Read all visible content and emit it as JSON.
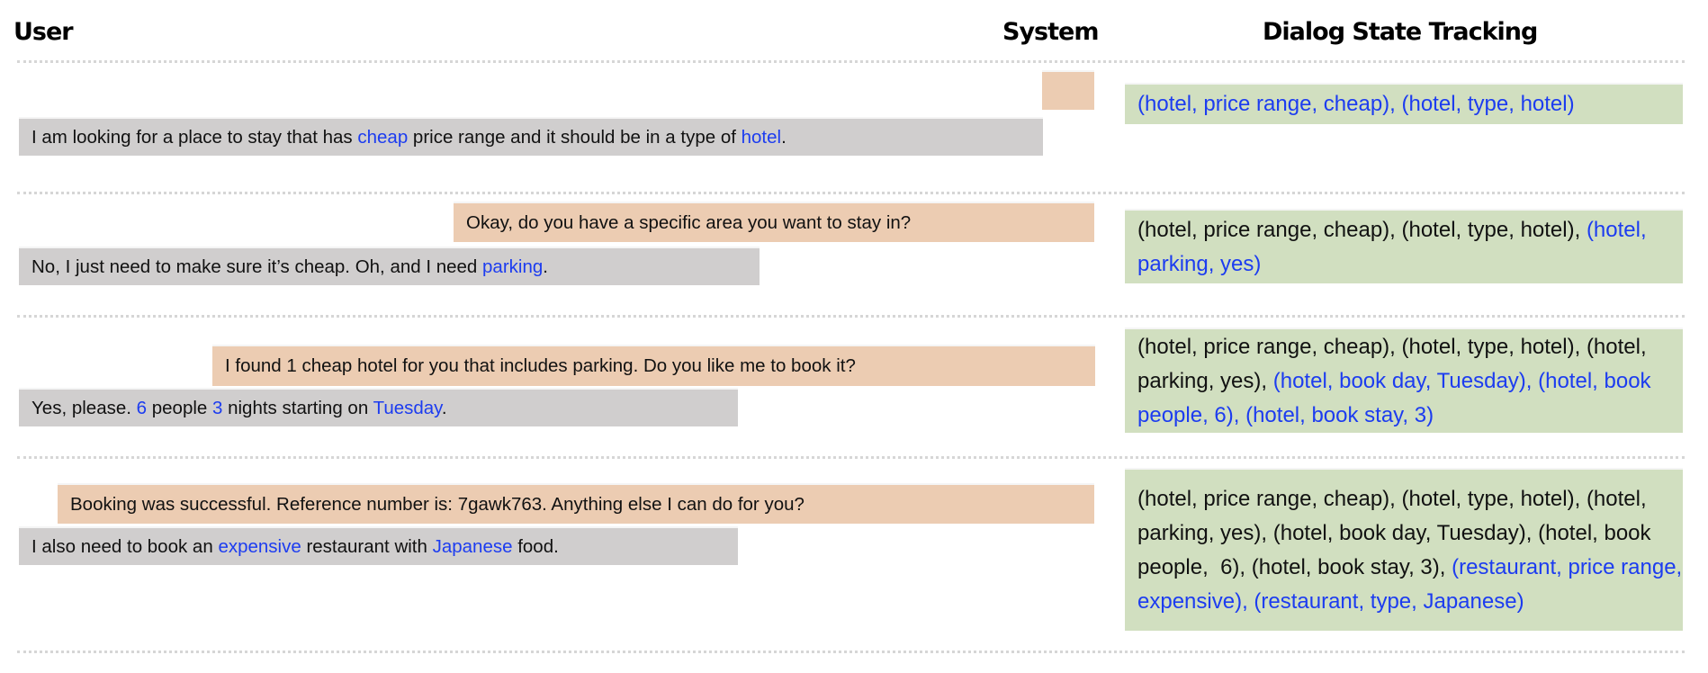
{
  "headers": {
    "user": "User",
    "system": "System",
    "dst": "Dialog State Tracking"
  },
  "colors": {
    "system_bubble": "#ecccb2",
    "user_bubble": "#d0cece",
    "dst_box": "#d1dfc0",
    "highlight": "#1c3cf0"
  },
  "turns": [
    {
      "system": [],
      "user": [
        {
          "text": "I am looking for a place to stay that has ",
          "hl": false
        },
        {
          "text": "cheap",
          "hl": true
        },
        {
          "text": " price range and it should be in a type of ",
          "hl": false
        },
        {
          "text": "hotel",
          "hl": true
        },
        {
          "text": ".",
          "hl": false
        }
      ],
      "dst": [
        {
          "text": "(hotel, price range, cheap), (hotel, type, hotel)",
          "hl": true
        }
      ]
    },
    {
      "system": [
        {
          "text": "Okay, do you have a specific area you want to stay in?",
          "hl": false
        }
      ],
      "user": [
        {
          "text": "No, I just need to make sure it’s cheap. Oh, and I need ",
          "hl": false
        },
        {
          "text": "parking",
          "hl": true
        },
        {
          "text": ".",
          "hl": false
        }
      ],
      "dst": [
        {
          "text": "(hotel, price range, cheap), (hotel, type, hotel), ",
          "hl": false
        },
        {
          "text": "(hotel, parking, yes)",
          "hl": true
        }
      ]
    },
    {
      "system": [
        {
          "text": "I found 1 cheap hotel for you that includes parking. Do you like me to book it?",
          "hl": false
        }
      ],
      "user": [
        {
          "text": "Yes, please. ",
          "hl": false
        },
        {
          "text": "6",
          "hl": true
        },
        {
          "text": " people ",
          "hl": false
        },
        {
          "text": "3",
          "hl": true
        },
        {
          "text": " nights starting on ",
          "hl": false
        },
        {
          "text": "Tuesday",
          "hl": true
        },
        {
          "text": ".",
          "hl": false
        }
      ],
      "dst": [
        {
          "text": "(hotel, price range, cheap), (hotel, type, hotel), (hotel, parking, yes), ",
          "hl": false
        },
        {
          "text": "(hotel, book day, Tuesday), (hotel, book people, 6), (hotel, book stay, 3)",
          "hl": true
        }
      ]
    },
    {
      "system": [
        {
          "text": "Booking was successful. Reference number is: 7gawk763. Anything else I can do for you?",
          "hl": false
        }
      ],
      "user": [
        {
          "text": "I also need to book an ",
          "hl": false
        },
        {
          "text": "expensive",
          "hl": true
        },
        {
          "text": " restaurant with ",
          "hl": false
        },
        {
          "text": "Japanese",
          "hl": true
        },
        {
          "text": " food.",
          "hl": false
        }
      ],
      "dst": [
        {
          "text": "(hotel, price range, cheap), (hotel, type, hotel), (hotel, parking, yes), (hotel, book day, Tuesday), (hotel, book people,  6), (hotel, book stay, 3), ",
          "hl": false
        },
        {
          "text": "(restaurant, price range, expensive), (restaurant, type, Japanese)",
          "hl": true
        }
      ]
    }
  ]
}
